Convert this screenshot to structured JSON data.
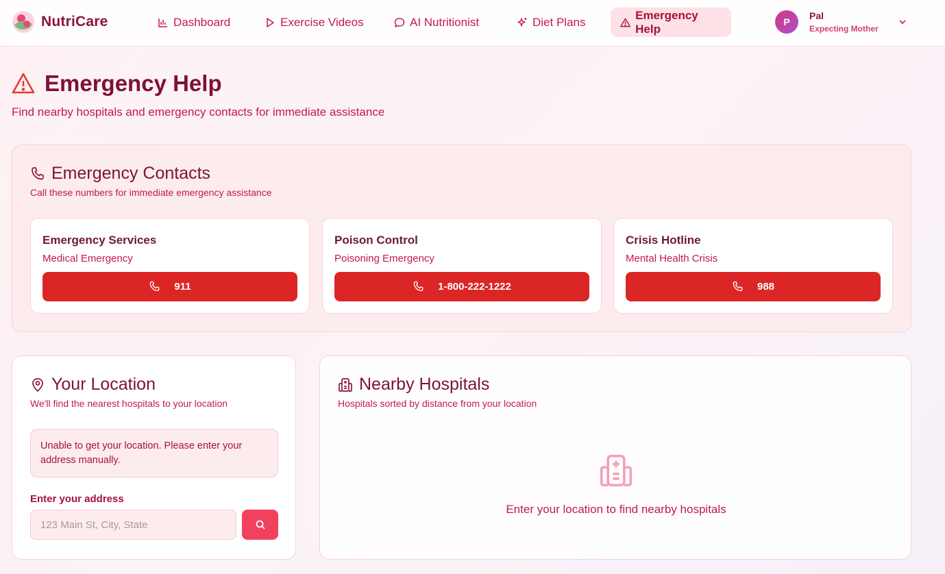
{
  "brand": {
    "name": "NutriCare"
  },
  "nav": {
    "items": [
      {
        "label": "Dashboard",
        "icon": "bar-chart-icon"
      },
      {
        "label": "Exercise Videos",
        "icon": "play-icon"
      },
      {
        "label": "AI Nutritionist",
        "icon": "chat-bubble-icon"
      },
      {
        "label": "Diet Plans",
        "icon": "sparkles-icon"
      },
      {
        "label": "Emergency Help",
        "icon": "alert-triangle-icon",
        "active": true
      }
    ]
  },
  "user": {
    "initial": "P",
    "name": "Pal",
    "role": "Expecting Mother"
  },
  "page": {
    "title": "Emergency Help",
    "subtitle": "Find nearby hospitals and emergency contacts for immediate assistance"
  },
  "contacts": {
    "title": "Emergency Contacts",
    "subtitle": "Call these numbers for immediate emergency assistance",
    "items": [
      {
        "name": "Emergency Services",
        "type": "Medical Emergency",
        "number": "911"
      },
      {
        "name": "Poison Control",
        "type": "Poisoning Emergency",
        "number": "1-800-222-1222"
      },
      {
        "name": "Crisis Hotline",
        "type": "Mental Health Crisis",
        "number": "988"
      }
    ]
  },
  "location": {
    "title": "Your Location",
    "subtitle": "We'll find the nearest hospitals to your location",
    "alert": "Unable to get your location. Please enter your address manually.",
    "field_label": "Enter your address",
    "placeholder": "123 Main St, City, State",
    "value": ""
  },
  "hospitals": {
    "title": "Nearby Hospitals",
    "subtitle": "Hospitals sorted by distance from your location",
    "empty_text": "Enter your location to find nearby hospitals"
  },
  "colors": {
    "primary": "#dc2626",
    "accent": "#f2405f",
    "brand": "#8a1538",
    "text_pink": "#c0184e"
  }
}
